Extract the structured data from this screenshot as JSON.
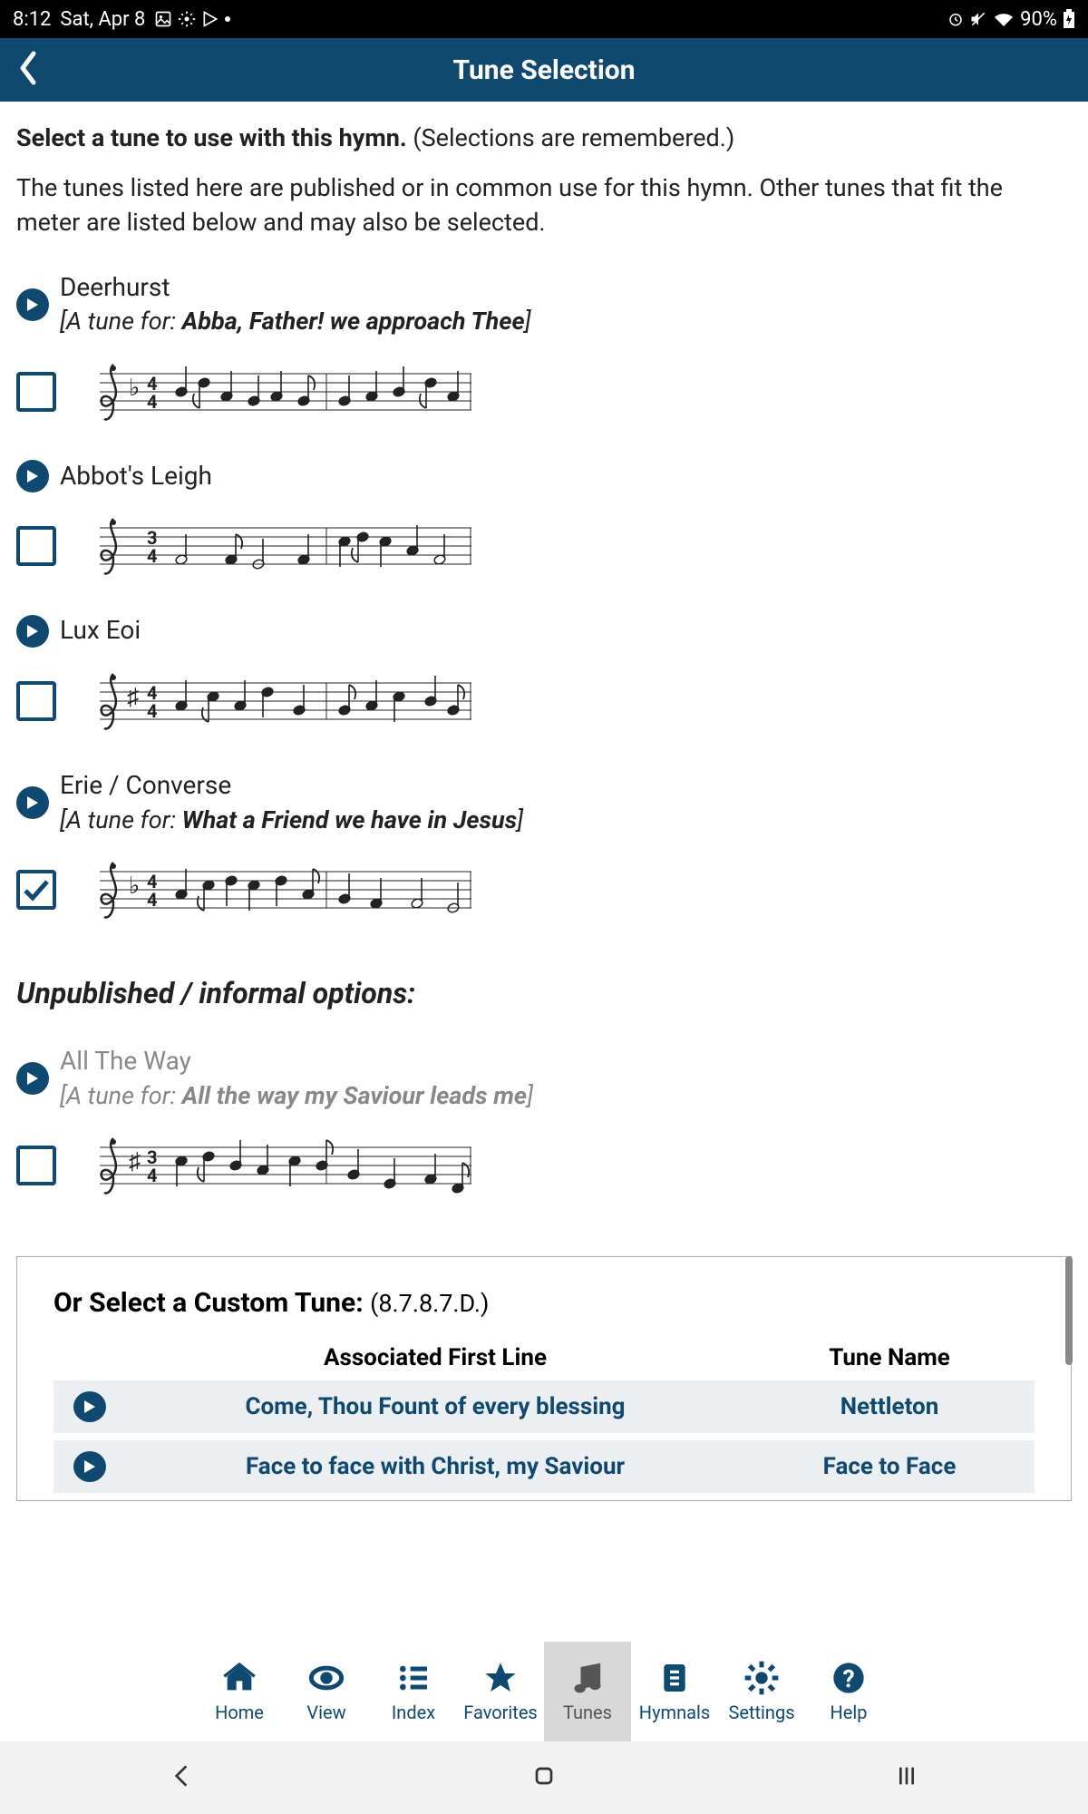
{
  "status": {
    "time": "8:12",
    "date": "Sat, Apr 8",
    "battery": "90%"
  },
  "app": {
    "title": "Tune Selection"
  },
  "intro": {
    "strong": "Select a tune to use with this hymn.",
    "rest": " (Selections are remembered.)",
    "desc": "The tunes listed here are published or in common use for this hymn. Other tunes that fit the meter are listed below and may also be selected."
  },
  "tunes": [
    {
      "name": "Deerhurst",
      "use_prefix": "[A tune for: ",
      "use_hymn": "Abba, Father! we approach Thee",
      "use_suffix": "]",
      "checked": false,
      "gray": false
    },
    {
      "name": "Abbot's Leigh",
      "use_prefix": "",
      "use_hymn": "",
      "use_suffix": "",
      "checked": false,
      "gray": false
    },
    {
      "name": "Lux Eoi",
      "use_prefix": "",
      "use_hymn": "",
      "use_suffix": "",
      "checked": false,
      "gray": false
    },
    {
      "name": "Erie / Converse",
      "use_prefix": "[A tune for: ",
      "use_hymn": "What a Friend we have in Jesus",
      "use_suffix": "]",
      "checked": true,
      "gray": false
    }
  ],
  "informal_heading": "Unpublished / informal options:",
  "informal_tunes": [
    {
      "name": "All The Way",
      "use_prefix": "[A tune for: ",
      "use_hymn": "All the way my Saviour leads me",
      "use_suffix": "]",
      "checked": false,
      "gray": true
    }
  ],
  "custom": {
    "heading": "Or Select a Custom Tune: ",
    "meter": "(8.7.8.7.D.)",
    "header_first": "Associated First Line",
    "header_tune": "Tune Name",
    "rows": [
      {
        "first": "Come, Thou Fount of every blessing",
        "tune": "Nettleton"
      },
      {
        "first": "Face to face with Christ, my Saviour",
        "tune": "Face to Face"
      }
    ]
  },
  "nav": {
    "items": [
      {
        "id": "home",
        "label": "Home"
      },
      {
        "id": "view",
        "label": "View"
      },
      {
        "id": "index",
        "label": "Index"
      },
      {
        "id": "favorites",
        "label": "Favorites"
      },
      {
        "id": "tunes",
        "label": "Tunes"
      },
      {
        "id": "hymnals",
        "label": "Hymnals"
      },
      {
        "id": "settings",
        "label": "Settings"
      },
      {
        "id": "help",
        "label": "Help"
      }
    ],
    "active": "tunes"
  }
}
